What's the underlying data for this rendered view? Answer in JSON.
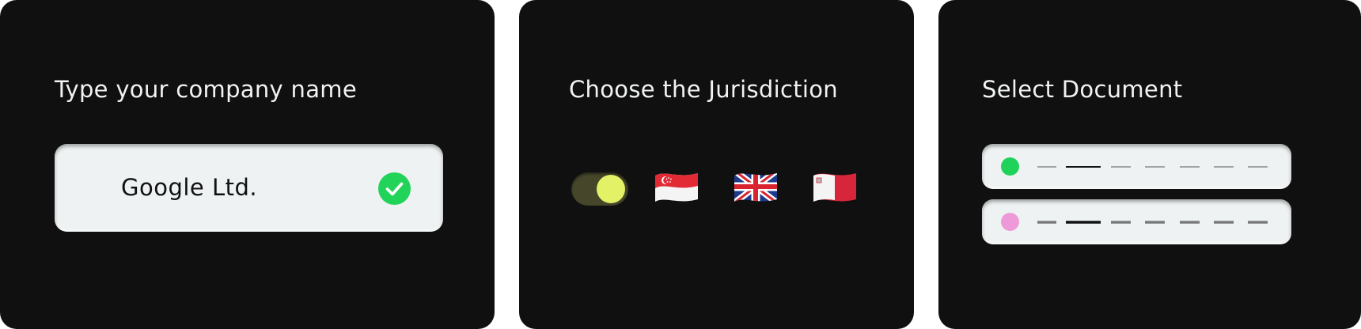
{
  "company_card": {
    "title": "Type your company name",
    "input_value": "Google Ltd.",
    "status_icon": "check-circle-icon",
    "status_color": "#22d35a"
  },
  "jurisdiction_card": {
    "title": "Choose the Jurisdiction",
    "toggle": {
      "state": "on",
      "track_color": "#46472a",
      "knob_color": "#e3f167"
    },
    "flags": [
      {
        "icon": "singapore-flag-icon"
      },
      {
        "icon": "united-kingdom-flag-icon"
      },
      {
        "icon": "malta-flag-icon"
      }
    ]
  },
  "document_card": {
    "title": "Select Document",
    "rows": [
      {
        "dot_color": "#1fd35a",
        "line_style": "thin"
      },
      {
        "dot_color": "#ee9ad9",
        "line_style": "thick"
      }
    ]
  },
  "colors": {
    "card_background": "#101010",
    "field_background": "#eef2f2",
    "title_text": "#f1f3f3"
  }
}
